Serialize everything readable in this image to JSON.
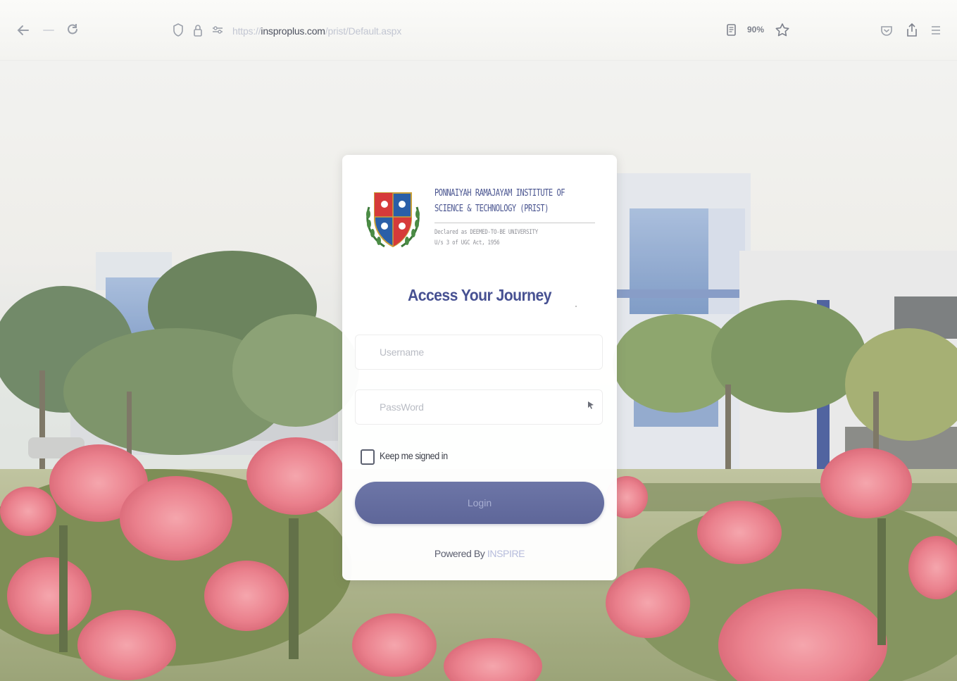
{
  "browser": {
    "url_scheme": "https://",
    "url_host": "insproplus.com",
    "url_path": "/prist/Default.aspx",
    "zoom_level": "90%"
  },
  "institution": {
    "name_line1": "PONNAIYAH RAMAJAYAM INSTITUTE OF",
    "name_line2": "SCIENCE & TECHNOLOGY (PRIST)",
    "sub_line1": "Declared as DEEMED-TO-BE UNIVERSITY",
    "sub_line2": "U/s 3 of UGC Act, 1956"
  },
  "login": {
    "title": "Access Your Journey",
    "username_placeholder": "Username",
    "password_placeholder": "PassWord",
    "keep_signed_in_label": "Keep me signed in",
    "login_button_label": "Login",
    "powered_by_label": "Powered By",
    "powered_by_brand": "INSPIRE"
  },
  "colors": {
    "accent": "#5e6699",
    "title": "#475192",
    "brand_muted": "#b6bcdc"
  },
  "icons": {
    "back": "back-arrow-icon",
    "forward": "forward-arrow-icon",
    "reload": "reload-icon",
    "shield": "tracking-shield-icon",
    "lock": "lock-icon",
    "permissions": "permissions-icon",
    "reader": "reader-view-icon",
    "bookmark": "bookmark-star-icon",
    "pocket": "pocket-icon",
    "share": "share-icon",
    "menu": "hamburger-menu-icon",
    "eye": "show-password-icon"
  }
}
